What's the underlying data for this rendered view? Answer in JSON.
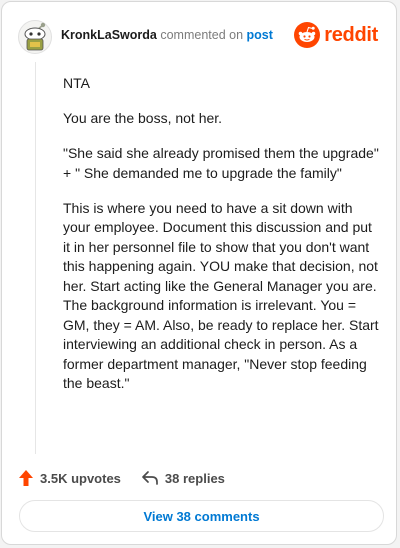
{
  "header": {
    "username": "KronkLaSworda",
    "action_text": "commented on",
    "post_link": "post",
    "brand": "reddit"
  },
  "comment": {
    "paragraphs": [
      "NTA",
      "You are the boss, not her.",
      "\"She said she already promised them the upgrade\" + \" She demanded me to upgrade the family\"",
      "This is where you need to have a sit down with your employee. Document this discussion and put it in her personnel file to show that you don't want this happening again. YOU make that decision, not her. Start acting like the General Manager you are. The background information is irrelevant. You = GM, they = AM. Also, be ready to replace her. Start interviewing an additional check in person. As a former department manager, \"Never stop feeding the beast.\""
    ]
  },
  "footer": {
    "upvotes": "3.5K upvotes",
    "replies": "38 replies",
    "view_button": "View 38 comments"
  },
  "colors": {
    "accent": "#ff4500",
    "link": "#0079d3"
  },
  "icons": {
    "avatar": "snoo-avatar",
    "brand": "reddit-logo-icon",
    "upvote": "upvote-arrow-icon",
    "reply": "reply-arrow-icon"
  }
}
